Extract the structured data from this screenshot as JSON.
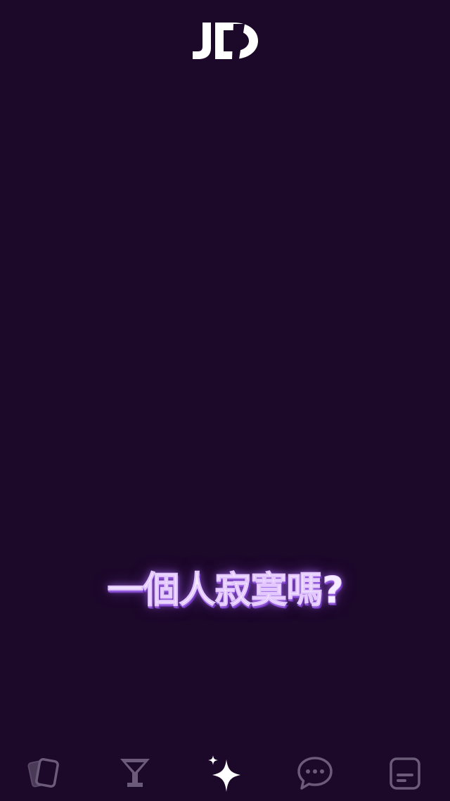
{
  "logo": {
    "text": "JD",
    "color": "#ffffff"
  },
  "tagline": "一個人寂寞嗎?",
  "colors": {
    "background": "#1c0829",
    "tagline_glow": "#a065e6",
    "nav_inactive": "#6b5a78",
    "nav_active": "#ffffff"
  },
  "bottom_nav": {
    "items": [
      {
        "icon": "cards-icon",
        "active": false
      },
      {
        "icon": "cocktail-icon",
        "active": false
      },
      {
        "icon": "sparkle-icon",
        "active": true
      },
      {
        "icon": "chat-bubble-icon",
        "active": false
      },
      {
        "icon": "message-card-icon",
        "active": false
      }
    ]
  }
}
